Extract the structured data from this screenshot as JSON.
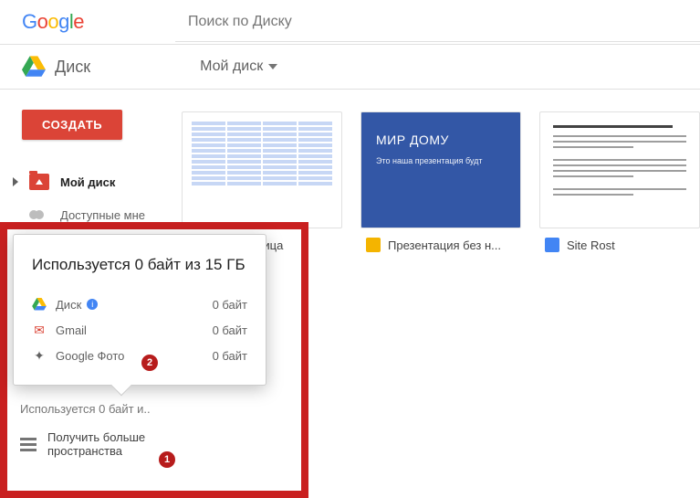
{
  "logo_text": "Google",
  "search": {
    "placeholder": "Поиск по Диску"
  },
  "brand": "Диск",
  "breadcrumb": "Мой диск",
  "create_button": "СОЗДАТЬ",
  "sidebar": {
    "items": [
      {
        "label": "Мой диск"
      },
      {
        "label": "Доступные мне"
      }
    ]
  },
  "files": [
    {
      "type": "sheets",
      "name": "овая таблица"
    },
    {
      "type": "slides",
      "name": "Презентация без н...",
      "slide_title": "МИР ДОМУ",
      "slide_sub": "Это наша презентация будт"
    },
    {
      "type": "docs",
      "name": "Site Rost"
    }
  ],
  "storage_popover": {
    "headline": "Используется 0 байт из 15 ГБ",
    "rows": [
      {
        "service": "Диск",
        "value": "0 байт"
      },
      {
        "service": "Gmail",
        "value": "0 байт"
      },
      {
        "service": "Google Фото",
        "value": "0 байт"
      }
    ]
  },
  "storage_summary": "Используется 0 байт и..",
  "get_more": {
    "line1": "Получить больше",
    "line2": "пространства"
  },
  "badges": {
    "one": "1",
    "two": "2"
  }
}
